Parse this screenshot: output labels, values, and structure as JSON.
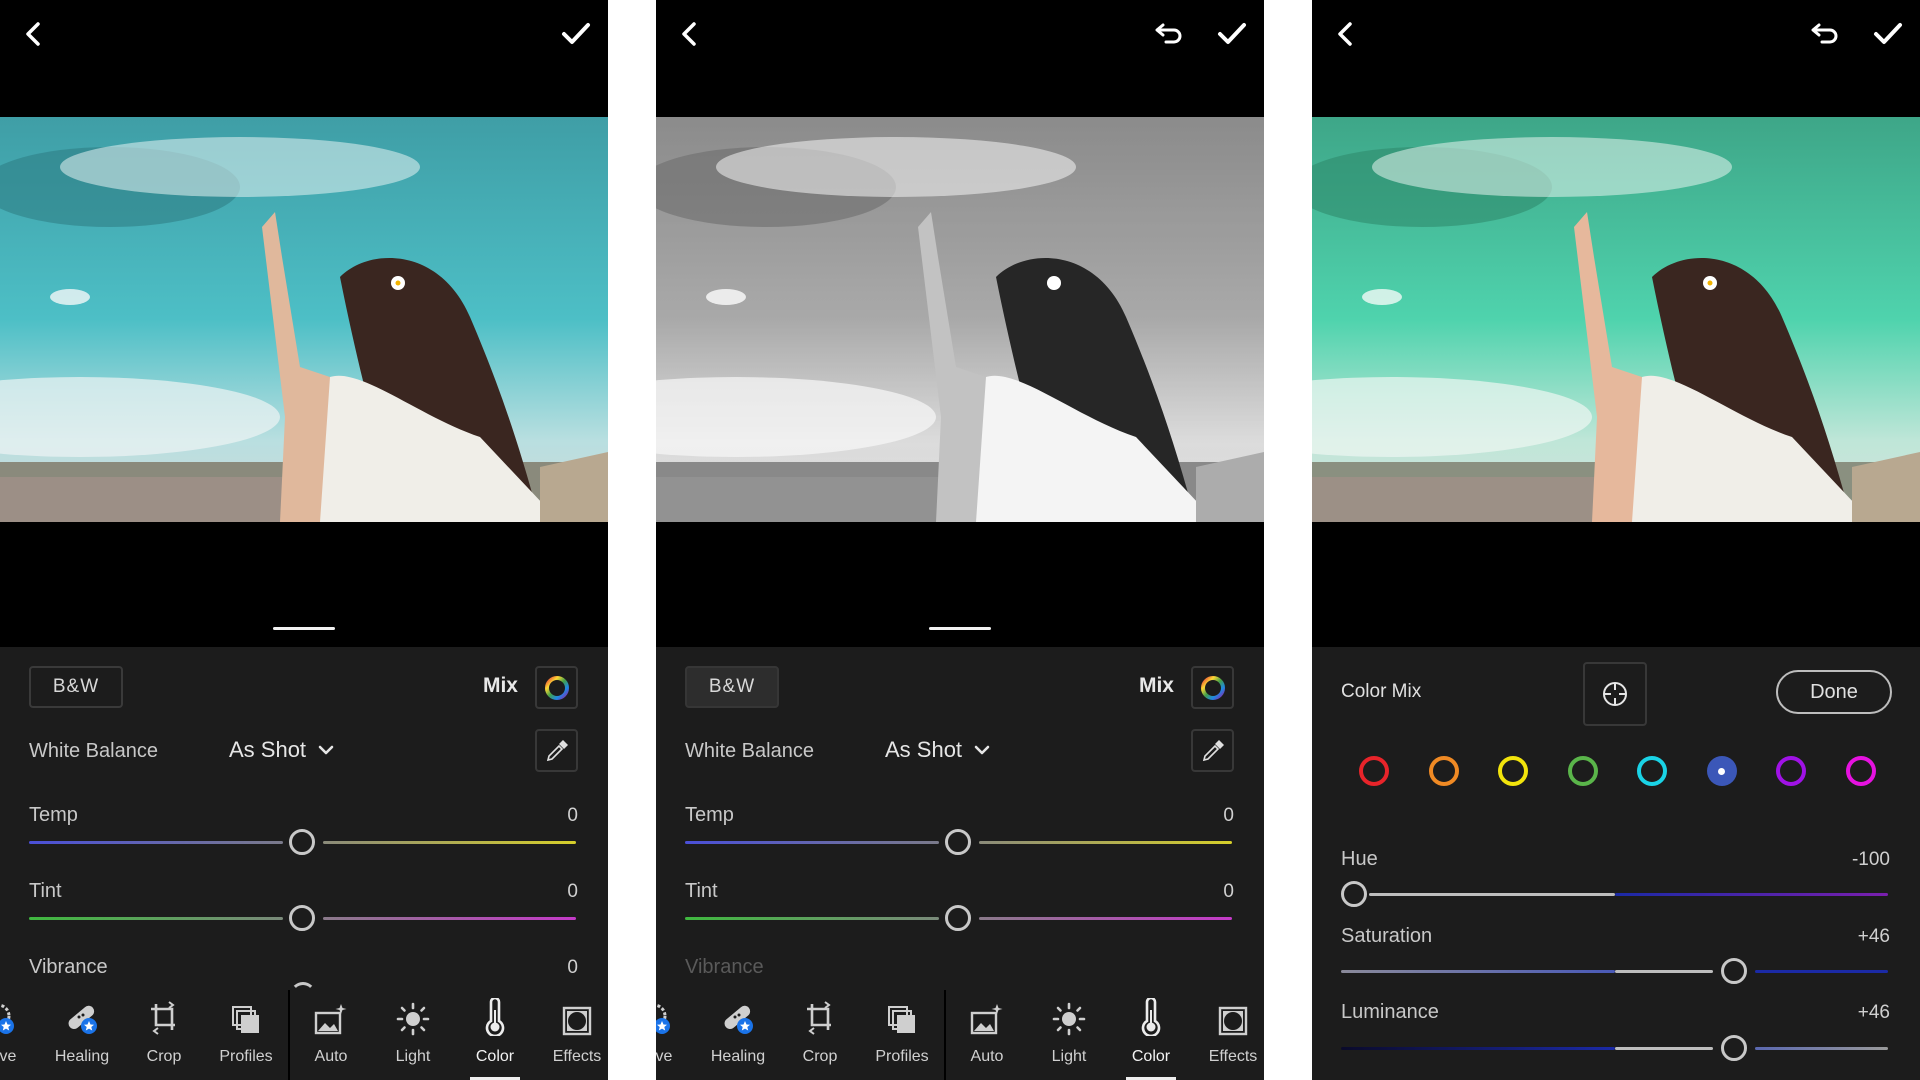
{
  "screens": [
    {
      "id": "color-panel",
      "topbar": {
        "back_icon": "chevron-left-icon",
        "confirm_icon": "checkmark-icon"
      },
      "photo": {
        "treatment": "color"
      },
      "bw_button": {
        "label": "B&W",
        "active": false
      },
      "mix": {
        "label": "Mix",
        "icon": "color-wheel-icon"
      },
      "white_balance": {
        "label": "White Balance",
        "value": "As Shot",
        "picker_icon": "eyedropper-icon"
      },
      "sliders": [
        {
          "label": "Temp",
          "value": "0"
        },
        {
          "label": "Tint",
          "value": "0"
        },
        {
          "label": "Vibrance",
          "value": "0"
        }
      ]
    },
    {
      "id": "bw-panel",
      "topbar": {
        "back_icon": "chevron-left-icon",
        "undo_icon": "undo-icon",
        "confirm_icon": "checkmark-icon"
      },
      "photo": {
        "treatment": "black-and-white"
      },
      "bw_button": {
        "label": "B&W",
        "active": true
      },
      "mix": {
        "label": "Mix",
        "icon": "color-wheel-icon"
      },
      "white_balance": {
        "label": "White Balance",
        "value": "As Shot",
        "picker_icon": "eyedropper-icon"
      },
      "sliders": [
        {
          "label": "Temp",
          "value": "0"
        },
        {
          "label": "Tint",
          "value": "0"
        },
        {
          "label": "Vibrance",
          "value": "",
          "disabled": true
        }
      ]
    },
    {
      "id": "color-mix-panel",
      "topbar": {
        "back_icon": "chevron-left-icon",
        "undo_icon": "undo-icon",
        "confirm_icon": "checkmark-icon"
      },
      "photo": {
        "treatment": "teal-shift"
      },
      "color_mix": {
        "title": "Color Mix",
        "target_icon": "target-adjustment-icon",
        "done_label": "Done",
        "swatches": [
          {
            "name": "red",
            "color": "#e8242a",
            "selected": false
          },
          {
            "name": "orange",
            "color": "#f08a24",
            "selected": false
          },
          {
            "name": "yellow",
            "color": "#f2e40c",
            "selected": false
          },
          {
            "name": "green",
            "color": "#5ab54a",
            "selected": false
          },
          {
            "name": "aqua",
            "color": "#1ad3e6",
            "selected": false
          },
          {
            "name": "blue",
            "color": "#3b57b8",
            "selected": true
          },
          {
            "name": "purple",
            "color": "#a012e6",
            "selected": false
          },
          {
            "name": "magenta",
            "color": "#e612e0",
            "selected": false
          }
        ],
        "sliders": [
          {
            "label": "Hue",
            "value": "-100",
            "numeric": -100
          },
          {
            "label": "Saturation",
            "value": "+46",
            "numeric": 46
          },
          {
            "label": "Luminance",
            "value": "+46",
            "numeric": 46
          }
        ]
      }
    }
  ],
  "toolbar": {
    "items": [
      {
        "label": "ctive",
        "icon": "selective-icon",
        "premium": true
      },
      {
        "label": "Healing",
        "icon": "bandage-icon",
        "premium": true
      },
      {
        "label": "Crop",
        "icon": "crop-icon"
      },
      {
        "label": "Profiles",
        "icon": "profiles-icon"
      },
      {
        "label": "Auto",
        "icon": "auto-enhance-icon"
      },
      {
        "label": "Light",
        "icon": "sun-icon"
      },
      {
        "label": "Color",
        "icon": "thermometer-icon",
        "active": true
      },
      {
        "label": "Effects",
        "icon": "vignette-icon"
      }
    ]
  },
  "colors": {
    "panel_bg": "#1c1c1c",
    "temp_left": "#4a4fd8",
    "temp_right": "#d6cf2a",
    "tint_left": "#3fb83f",
    "tint_right": "#c43ac8",
    "hue_blue": "#1b2aa6",
    "hue_purple": "#7a1fae"
  }
}
